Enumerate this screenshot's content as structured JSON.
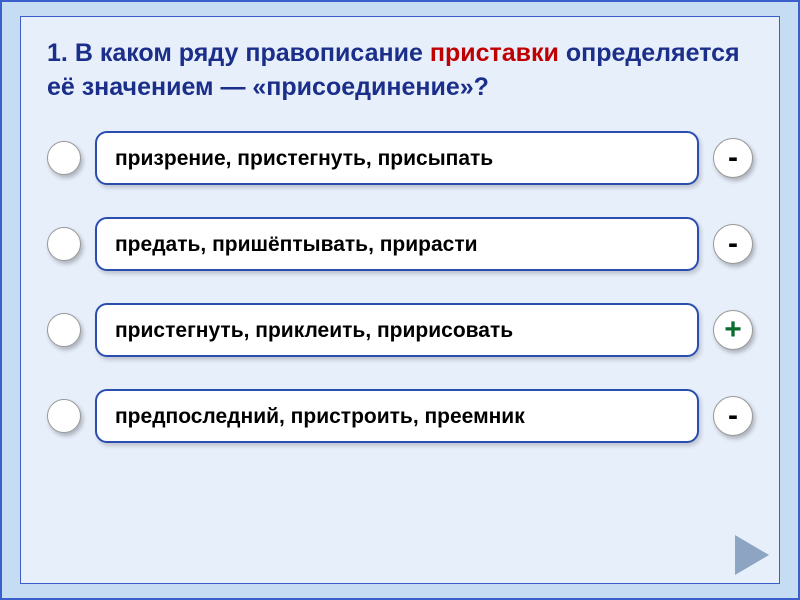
{
  "question": {
    "number_label": "1.",
    "lead": "В каком ряду правописание",
    "emphasis": "приставки",
    "tail": "определяется её значением — «присоединение»?"
  },
  "options": [
    {
      "text": "призрение, пристегнуть, присыпать",
      "mark": "-",
      "mark_kind": "minus"
    },
    {
      "text": "предать, пришёптывать, прирасти",
      "mark": "-",
      "mark_kind": "minus"
    },
    {
      "text": "пристегнуть, приклеить, пририсовать",
      "mark": "+",
      "mark_kind": "plus"
    },
    {
      "text": "предпоследний, пристроить, преемник",
      "mark": "-",
      "mark_kind": "minus"
    }
  ]
}
